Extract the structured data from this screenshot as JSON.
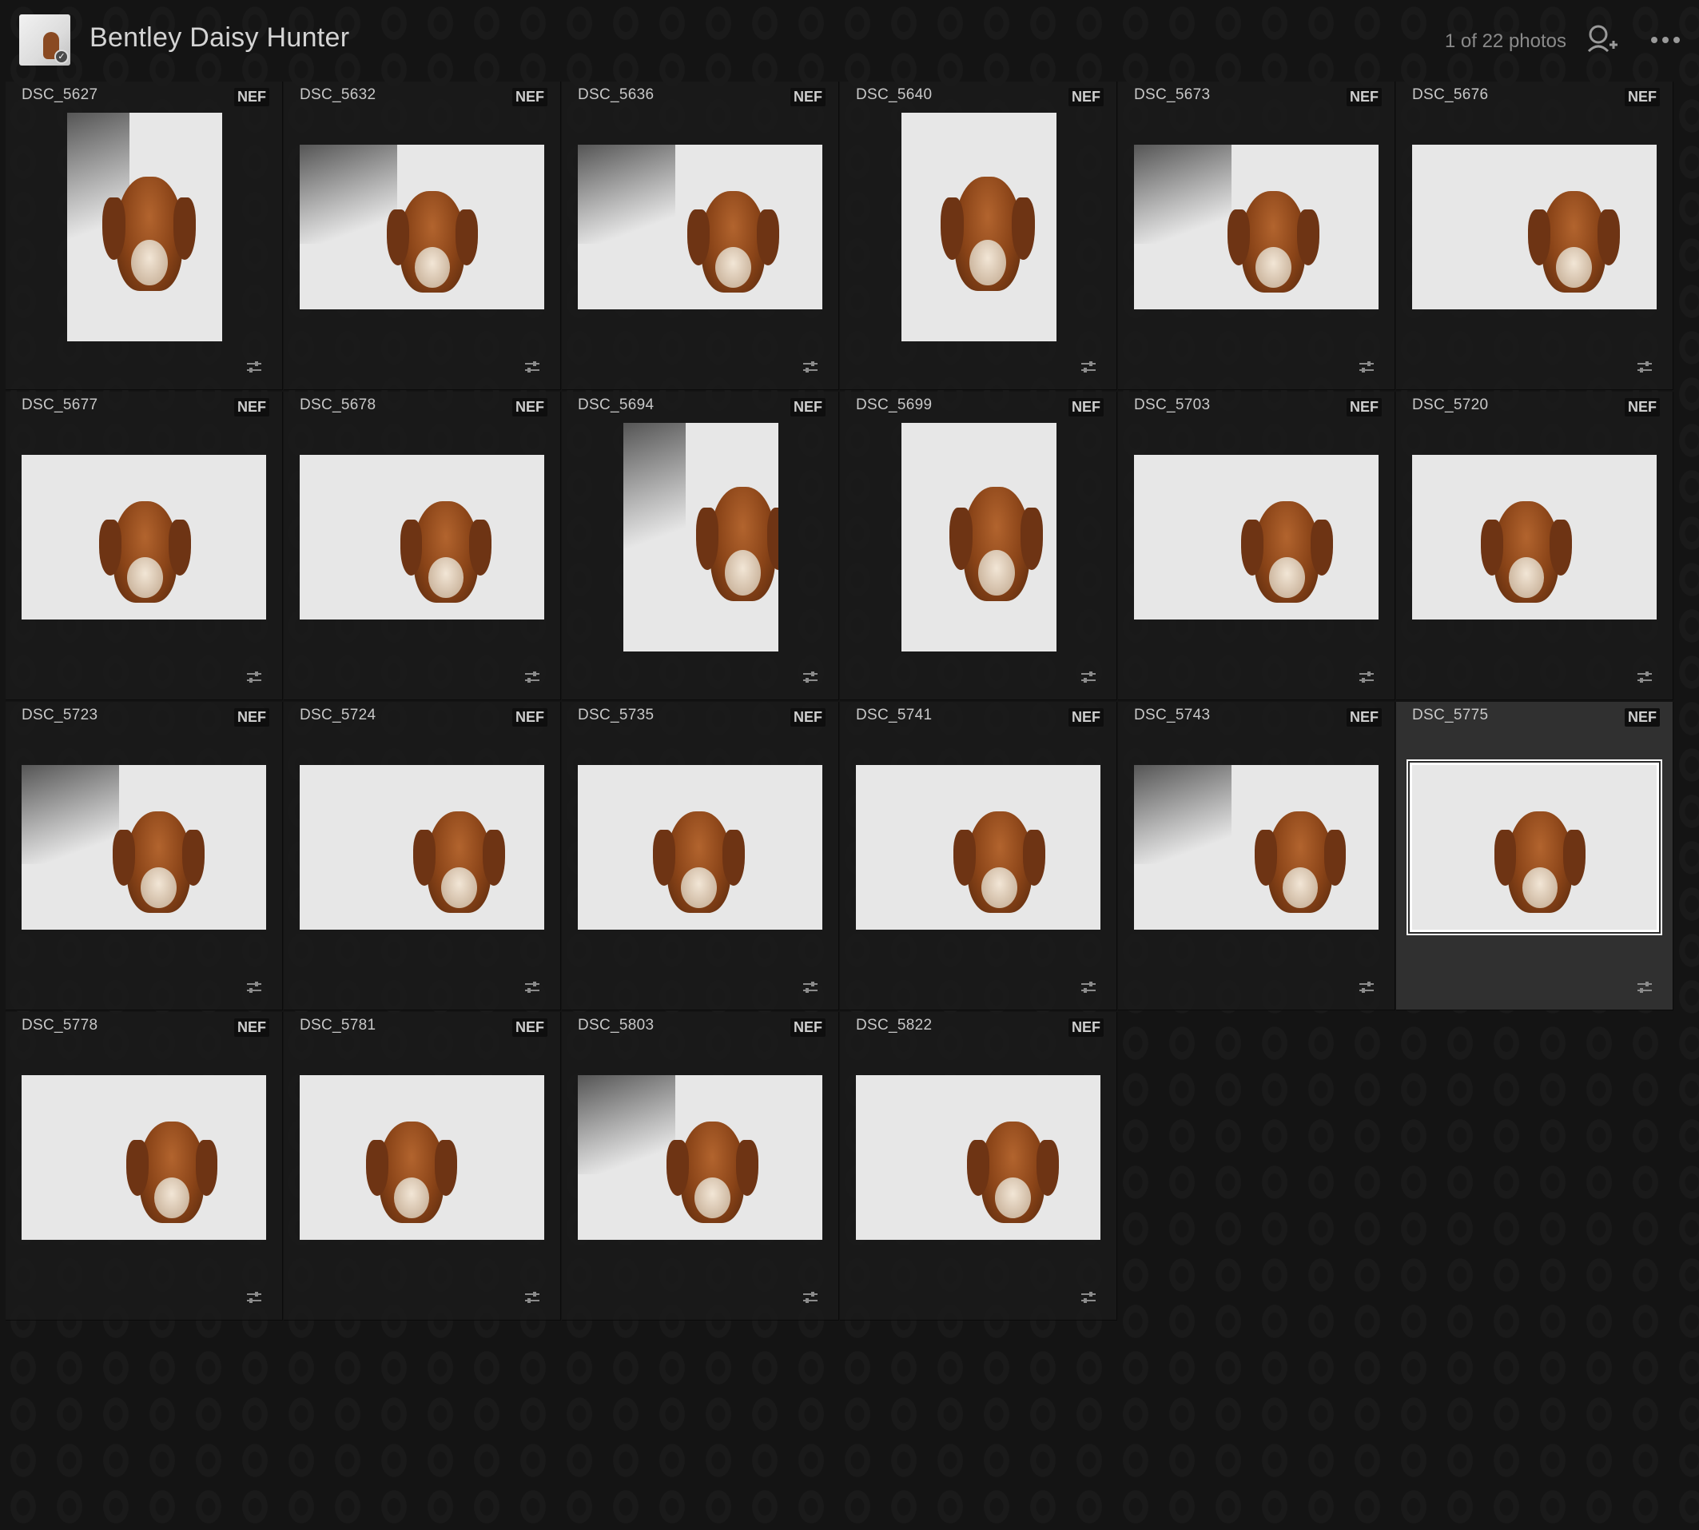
{
  "header": {
    "album_title": "Bentley Daisy Hunter",
    "photo_count": "1 of 22 photos",
    "share_icon": "add-person-icon",
    "more_icon": "more-horizontal-icon"
  },
  "colors": {
    "background": "#141414",
    "cell": "#1a1a1a",
    "cell_selected": "#323232",
    "selection_outline": "#ffffff"
  },
  "photos": [
    {
      "name": "DSC_5627",
      "format": "NEF",
      "orientation": "portrait"
    },
    {
      "name": "DSC_5632",
      "format": "NEF",
      "orientation": "landscape"
    },
    {
      "name": "DSC_5636",
      "format": "NEF",
      "orientation": "landscape"
    },
    {
      "name": "DSC_5640",
      "format": "NEF",
      "orientation": "portrait"
    },
    {
      "name": "DSC_5673",
      "format": "NEF",
      "orientation": "landscape"
    },
    {
      "name": "DSC_5676",
      "format": "NEF",
      "orientation": "landscape"
    },
    {
      "name": "DSC_5677",
      "format": "NEF",
      "orientation": "landscape"
    },
    {
      "name": "DSC_5678",
      "format": "NEF",
      "orientation": "landscape"
    },
    {
      "name": "DSC_5694",
      "format": "NEF",
      "orientation": "portrait"
    },
    {
      "name": "DSC_5699",
      "format": "NEF",
      "orientation": "portrait"
    },
    {
      "name": "DSC_5703",
      "format": "NEF",
      "orientation": "landscape"
    },
    {
      "name": "DSC_5720",
      "format": "NEF",
      "orientation": "landscape"
    },
    {
      "name": "DSC_5723",
      "format": "NEF",
      "orientation": "landscape"
    },
    {
      "name": "DSC_5724",
      "format": "NEF",
      "orientation": "landscape"
    },
    {
      "name": "DSC_5735",
      "format": "NEF",
      "orientation": "landscape"
    },
    {
      "name": "DSC_5741",
      "format": "NEF",
      "orientation": "landscape"
    },
    {
      "name": "DSC_5743",
      "format": "NEF",
      "orientation": "landscape"
    },
    {
      "name": "DSC_5775",
      "format": "NEF",
      "orientation": "landscape",
      "selected": true
    },
    {
      "name": "DSC_5778",
      "format": "NEF",
      "orientation": "landscape"
    },
    {
      "name": "DSC_5781",
      "format": "NEF",
      "orientation": "landscape"
    },
    {
      "name": "DSC_5803",
      "format": "NEF",
      "orientation": "landscape"
    },
    {
      "name": "DSC_5822",
      "format": "NEF",
      "orientation": "landscape"
    }
  ]
}
